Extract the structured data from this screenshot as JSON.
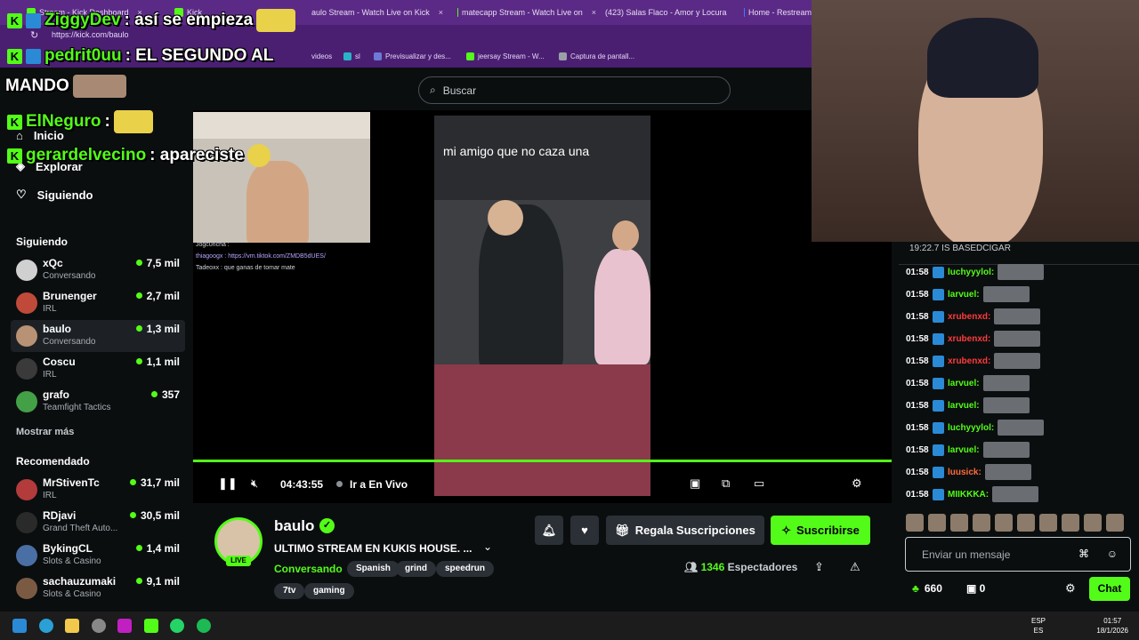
{
  "browser": {
    "tabs": [
      {
        "label": "Stream - Kick Dashboard"
      },
      {
        "label": "Kick"
      },
      {
        "label": "aulo Stream - Watch Live on Kick"
      },
      {
        "label": "matecapp Stream - Watch Live on"
      },
      {
        "label": "(423) Salas Flaco - Amor y Locura"
      },
      {
        "label": "Home - Restream"
      }
    ],
    "url": "https://kick.com/baulo",
    "bookmarks": [
      {
        "label": "videos"
      },
      {
        "label": "sl"
      },
      {
        "label": "Previsualizar y des..."
      },
      {
        "label": "jeersay Stream - W..."
      },
      {
        "label": "Captura de pantall..."
      }
    ]
  },
  "header": {
    "search_placeholder": "Buscar"
  },
  "sidebar": {
    "nav": [
      {
        "label": "Inicio",
        "icon": "home-icon"
      },
      {
        "label": "Explorar",
        "icon": "compass-icon"
      },
      {
        "label": "Siguiendo",
        "icon": "heart-icon"
      }
    ],
    "following_title": "Siguiendo",
    "following": [
      {
        "name": "xQc",
        "category": "Conversando",
        "viewers": "7,5 mil",
        "color": "#d0d0d0"
      },
      {
        "name": "Brunenger",
        "category": "IRL",
        "viewers": "2,7 mil",
        "color": "#c04a3a"
      },
      {
        "name": "baulo",
        "category": "Conversando",
        "viewers": "1,3 mil",
        "color": "#b89274"
      },
      {
        "name": "Coscu",
        "category": "IRL",
        "viewers": "1,1 mil",
        "color": "#3a3a3a"
      },
      {
        "name": "grafo",
        "category": "Teamfight Tactics",
        "viewers": "357",
        "color": "#43a047"
      }
    ],
    "show_more": "Mostrar más",
    "recommended_title": "Recomendado",
    "recommended": [
      {
        "name": "MrStivenTc",
        "category": "IRL",
        "viewers": "31,7 mil",
        "color": "#b33b3b"
      },
      {
        "name": "RDjavi",
        "category": "Grand Theft Auto...",
        "viewers": "30,5 mil",
        "color": "#2a2a2a"
      },
      {
        "name": "BykingCL",
        "category": "Slots & Casino",
        "viewers": "1,4 mil",
        "color": "#4a6fa5"
      },
      {
        "name": "sachauzumaki",
        "category": "Slots & Casino",
        "viewers": "9,1 mil",
        "color": "#7b5a44"
      }
    ]
  },
  "player": {
    "tiktok_caption": "mi amigo que no caza una",
    "time": "04:43:55",
    "go_live": "Ir a En Vivo",
    "chat_lines": [
      "Jogc0ncha :",
      "thiagoogx : https://vm.tiktok.com/ZMDB5dUES/",
      "Tadeoxx : que ganas de tomar mate"
    ]
  },
  "stream": {
    "name": "baulo",
    "live_label": "LIVE",
    "title": "ULTIMO STREAM EN KUKIS HOUSE. ...",
    "category": "Conversando",
    "tags": [
      "Spanish",
      "grind",
      "speedrun",
      "7tv",
      "gaming"
    ],
    "gift_label": "Regala Suscripciones",
    "subscribe_label": "Suscribirse",
    "viewer_count": "1346",
    "viewer_label": "Espectadores"
  },
  "chat": {
    "pinned": "19:22.7 IS BASEDCIGAR",
    "messages": [
      {
        "time": "01:58",
        "user": "luchyyylol:",
        "color": "#53fc18"
      },
      {
        "time": "01:58",
        "user": "larvuel:",
        "color": "#53fc18"
      },
      {
        "time": "01:58",
        "user": "xrubenxd:",
        "color": "#ff3b3b"
      },
      {
        "time": "01:58",
        "user": "xrubenxd:",
        "color": "#ff3b3b"
      },
      {
        "time": "01:58",
        "user": "xrubenxd:",
        "color": "#ff3b3b"
      },
      {
        "time": "01:58",
        "user": "larvuel:",
        "color": "#53fc18"
      },
      {
        "time": "01:58",
        "user": "larvuel:",
        "color": "#53fc18"
      },
      {
        "time": "01:58",
        "user": "luchyyylol:",
        "color": "#53fc18"
      },
      {
        "time": "01:58",
        "user": "larvuel:",
        "color": "#53fc18"
      },
      {
        "time": "01:58",
        "user": "luusick:",
        "color": "#ff6b3b"
      },
      {
        "time": "01:58",
        "user": "MIIKKKA:",
        "color": "#53fc18"
      }
    ],
    "input_placeholder": "Enviar un mensaje",
    "points": "660",
    "drops": "0",
    "send_label": "Chat"
  },
  "overlay": [
    {
      "user": "ZiggyDev",
      "text": ": así se empieza"
    },
    {
      "user": "pedrit0uu",
      "text": ": EL SEGUNDO AL"
    },
    {
      "user": "",
      "text": "MANDO"
    },
    {
      "user": "ElNeguro",
      "text": ":"
    },
    {
      "user": "gerardelvecino",
      "text": ": apareciste"
    }
  ],
  "taskbar": {
    "lang_top": "ESP",
    "lang_bottom": "ES",
    "time": "01:57",
    "date": "18/1/2026"
  },
  "colors": {
    "accent": "#53fc18",
    "background": "#0b0e0f",
    "browser": "#5b2a86"
  }
}
